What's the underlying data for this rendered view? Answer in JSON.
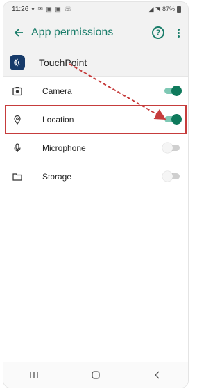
{
  "status_bar": {
    "time": "11:26",
    "battery": "87%"
  },
  "app_bar": {
    "title": "App permissions",
    "back_icon": "arrow-left-icon",
    "help_icon": "help-circle-icon",
    "more_icon": "more-vertical-icon"
  },
  "app": {
    "name": "TouchPoint",
    "logo_icon": "touchpoint-logo-icon"
  },
  "permissions": [
    {
      "label": "Camera",
      "icon": "camera-icon",
      "enabled": true
    },
    {
      "label": "Location",
      "icon": "location-pin-icon",
      "enabled": true
    },
    {
      "label": "Microphone",
      "icon": "microphone-icon",
      "enabled": false
    },
    {
      "label": "Storage",
      "icon": "folder-icon",
      "enabled": false
    }
  ],
  "nav_bar": {
    "recents_icon": "recents-icon",
    "home_icon": "home-icon",
    "back_icon": "back-chevron-icon"
  },
  "colors": {
    "accent": "#1a7d6a",
    "toggle_on_knob": "#0f7a5c",
    "toggle_on_track": "#7ec8b4",
    "annotation_red": "#c63c3c"
  }
}
